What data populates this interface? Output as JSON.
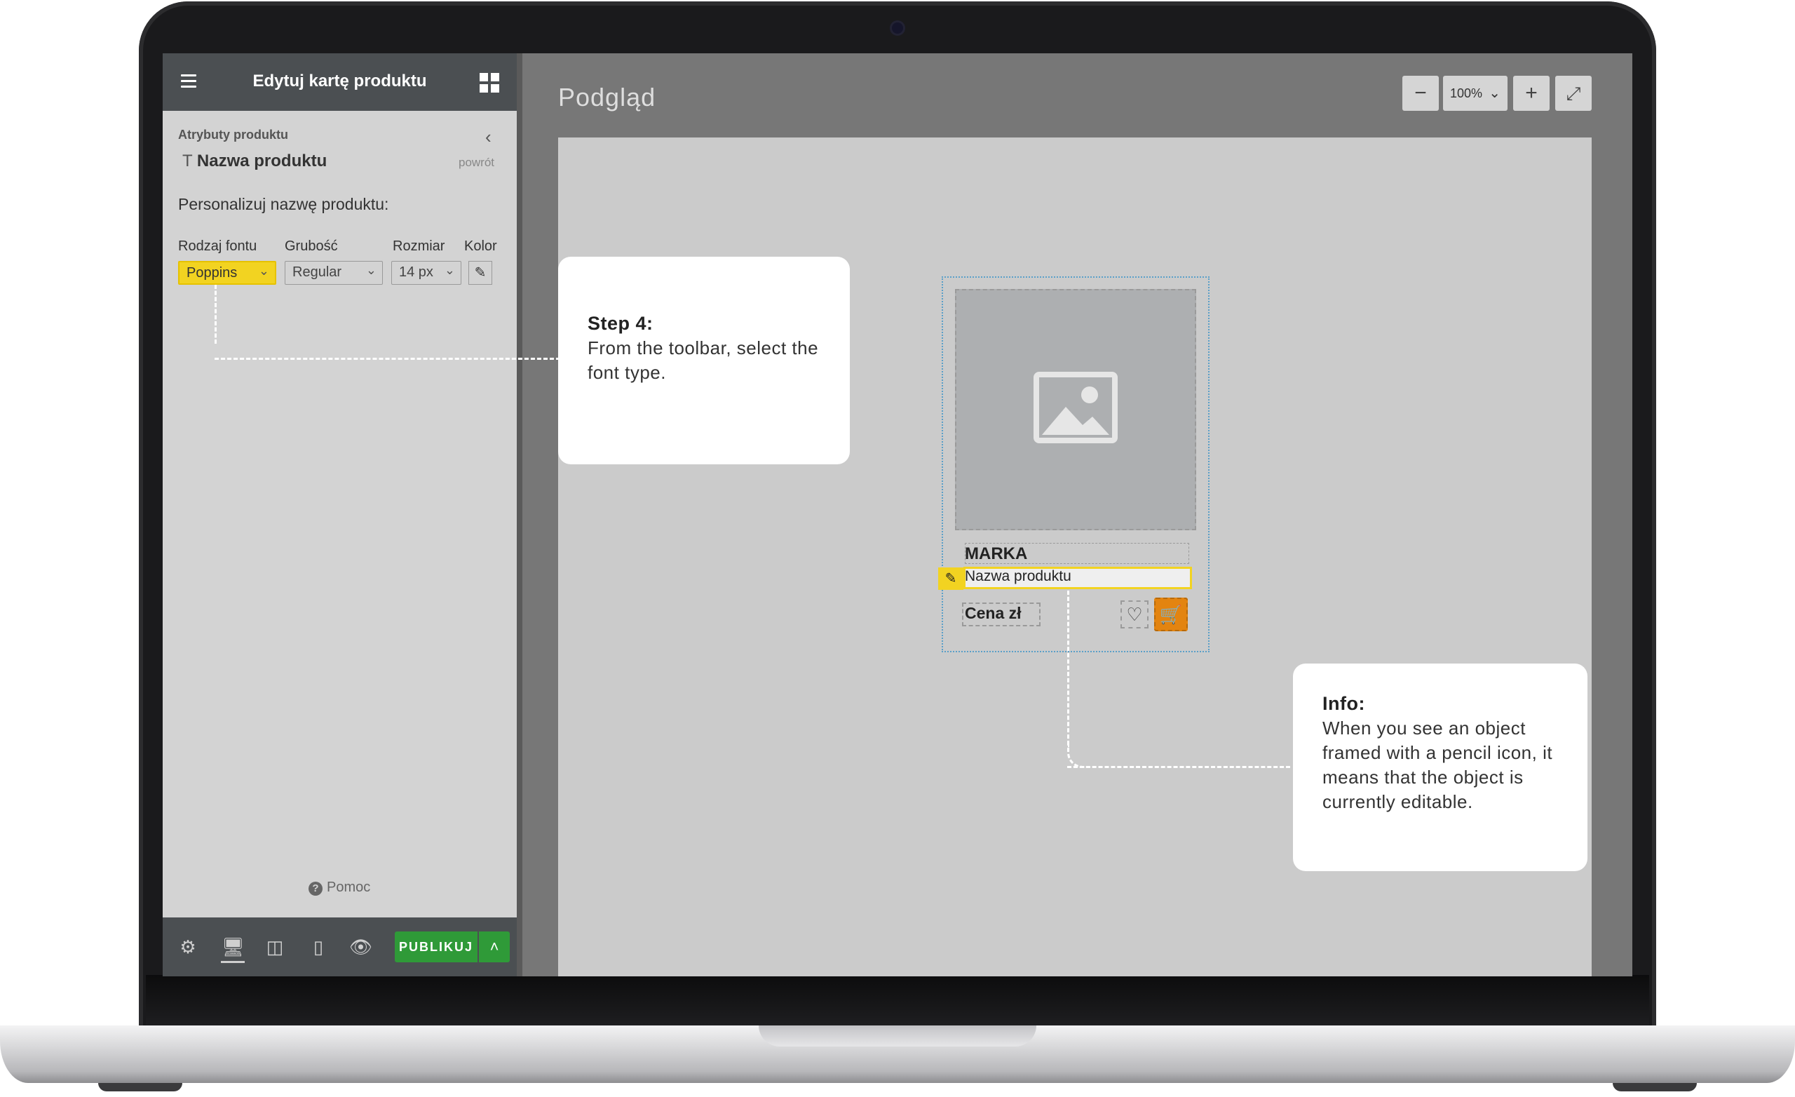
{
  "sidebar": {
    "title": "Edytuj kartę produktu",
    "breadcrumb": "Atrybuty produktu",
    "attribute_title": "Nazwa produktu",
    "back_label": "powrót",
    "personalize_label": "Personalizuj nazwę produktu:",
    "font_type": {
      "label": "Rodzaj fontu",
      "value": "Poppins"
    },
    "weight": {
      "label": "Grubość",
      "value": "Regular"
    },
    "size": {
      "label": "Rozmiar",
      "value": "14 px"
    },
    "color": {
      "label": "Kolor"
    },
    "help_label": "Pomoc",
    "publish_label": "PUBLIKUJ"
  },
  "preview": {
    "title": "Podgląd",
    "zoom_value": "100%"
  },
  "product_card": {
    "brand": "MARKA",
    "name": "Nazwa produktu",
    "price": "Cena zł"
  },
  "callouts": {
    "step": {
      "heading": "Step 4:",
      "body": "From the toolbar, select the font type."
    },
    "info": {
      "heading": "Info:",
      "body": "When you see an object framed with a pencil icon, it means that the object is currently editable."
    }
  },
  "colors": {
    "highlight": "#f2d321",
    "publish": "#2f9a38",
    "cart": "#e38410",
    "header": "#4b4f52"
  }
}
